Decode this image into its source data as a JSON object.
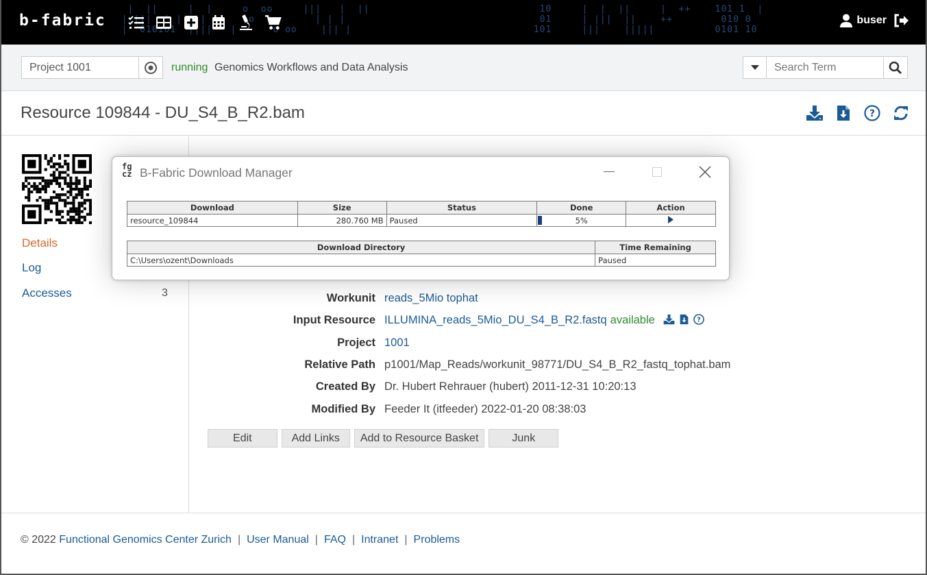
{
  "header": {
    "logo": "b-fabric",
    "username": "buser",
    "nav_icons": [
      "tasks-icon",
      "grid-icon",
      "plus-square-icon",
      "calendar-icon",
      "microscope-icon",
      "cart-icon"
    ]
  },
  "project_bar": {
    "project_value": "Project 1001",
    "status": "running",
    "project_name": "Genomics Workflows and Data Analysis",
    "search_placeholder": "Search Term"
  },
  "page": {
    "title": "Resource 109844 - DU_S4_B_R2.bam"
  },
  "sidebar": {
    "items": [
      {
        "label": "Details",
        "active": true
      },
      {
        "label": "Log"
      },
      {
        "label": "Accesses",
        "count": "3"
      }
    ]
  },
  "details": {
    "workunit_label": "Workunit",
    "workunit_value": "reads_5Mio tophat",
    "input_resource_label": "Input Resource",
    "input_resource_value": "ILLUMINA_reads_5Mio_DU_S4_B_R2.fastq",
    "input_resource_status": "available",
    "project_label": "Project",
    "project_value": "1001",
    "relative_path_label": "Relative Path",
    "relative_path_value": "p1001/Map_Reads/workunit_98771/DU_S4_B_R2_fastq_tophat.bam",
    "created_by_label": "Created By",
    "created_by_value": "Dr. Hubert Rehrauer (hubert) 2011-12-31 10:20:13",
    "modified_by_label": "Modified By",
    "modified_by_value": "Feeder It (itfeeder) 2022-01-20 08:38:03"
  },
  "actions": {
    "edit": "Edit",
    "add_links": "Add Links",
    "add_basket": "Add to Resource Basket",
    "junk": "Junk"
  },
  "footer": {
    "copyright": "© 2022",
    "org": "Functional Genomics Center Zurich",
    "user_manual": "User Manual",
    "faq": "FAQ",
    "intranet": "Intranet",
    "problems": "Problems"
  },
  "download_manager": {
    "logo_line1": "fg",
    "logo_line2": "cz",
    "title": "B-Fabric Download Manager",
    "table_headers": {
      "download": "Download",
      "size": "Size",
      "status": "Status",
      "done": "Done",
      "action": "Action"
    },
    "row": {
      "download": "resource_109844",
      "size": "280.760 MB",
      "status": "Paused",
      "done": "5%",
      "progress_fraction": 0.05
    },
    "dir_headers": {
      "directory": "Download Directory",
      "time_remaining": "Time Remaining"
    },
    "dir_row": {
      "directory": "C:\\Users\\ozent\\Downloads",
      "time_remaining": "Paused"
    }
  },
  "colors": {
    "link": "#1a5a96",
    "active": "#d5692a",
    "status_green": "#2e8b2e",
    "progress": "#1c3f78"
  }
}
